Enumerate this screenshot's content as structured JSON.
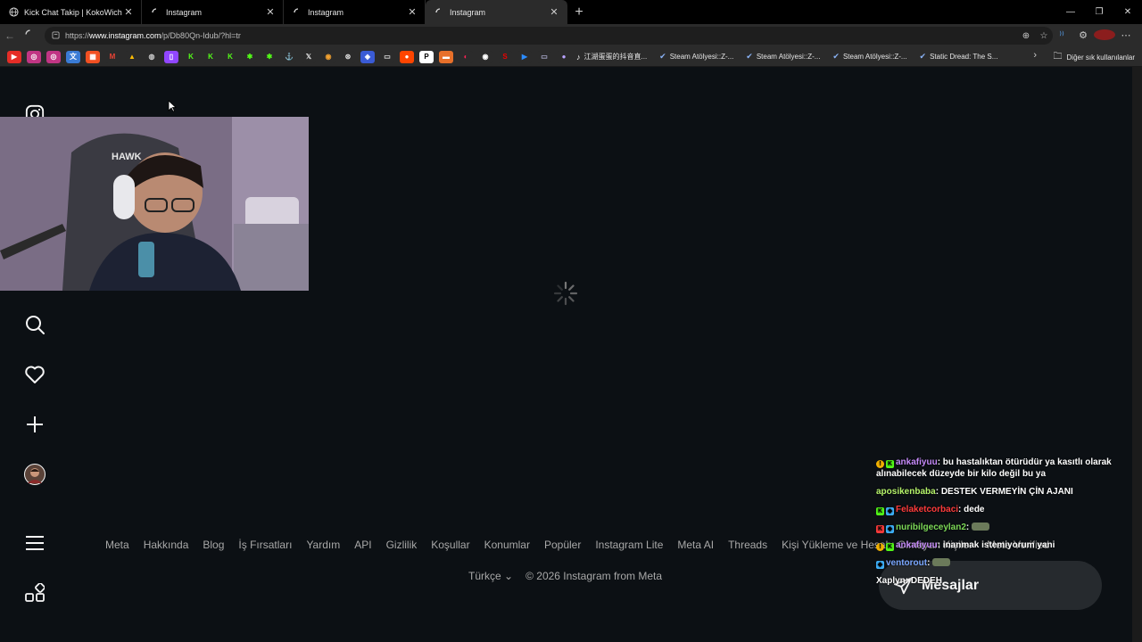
{
  "browser": {
    "tabs": [
      {
        "title": "Kick Chat Takip | KokoWich",
        "icon": "globe-icon",
        "active": false
      },
      {
        "title": "Instagram",
        "icon": "loading-icon",
        "active": false
      },
      {
        "title": "Instagram",
        "icon": "loading-icon",
        "active": false
      },
      {
        "title": "Instagram",
        "icon": "loading-icon",
        "active": true
      }
    ],
    "url_prefix": "https://",
    "url_host": "www.instagram.com",
    "url_path": "/p/Db80Qn-Idub/?hl=tr",
    "bookmarks": [
      {
        "label": "Steam Atölyesi::Z-...",
        "icon": "steam-icon"
      },
      {
        "label": "Steam Atölyesi::Z-...",
        "icon": "steam-icon"
      },
      {
        "label": "Steam Atölyesi::Z-...",
        "icon": "steam-icon"
      },
      {
        "label": "Static Dread: The S...",
        "icon": "steam-icon"
      }
    ],
    "bookmark_cn": "江湖蛋蛋的抖音直...",
    "bookmarks_other": "Diğer sık kullanılanlar"
  },
  "footer": {
    "links": [
      "Meta",
      "Hakkında",
      "Blog",
      "İş Fırsatları",
      "Yardım",
      "API",
      "Gizlilik",
      "Koşullar",
      "Konumlar",
      "Popüler",
      "Instagram Lite",
      "Meta AI",
      "Threads",
      "Kişi Yükleme ve Hesabı Olmayan Kişiler",
      "Meta Verified"
    ],
    "language": "Türkçe",
    "copyright": "© 2026 Instagram from Meta"
  },
  "chat": [
    {
      "user": "ankafiyuu",
      "text": "bu hastalıktan ötürüdür ya kasıtlı olarak alınabilecek düzeyde bir kilo değil bu ya",
      "color": "#c58af9"
    },
    {
      "user": "aposikenbaba",
      "text": "DESTEK VERMEYİN ÇİN AJANI",
      "color": "#b6f36b"
    },
    {
      "user": "Felaketcorbaci",
      "text": "dede",
      "color": "#ff3b3b"
    },
    {
      "user": "nuribilgeceylan2",
      "text": "",
      "color": "#7cd957"
    },
    {
      "user": "ankafiyuu",
      "text": "inanmak istemiyorum yani",
      "color": "#c58af9"
    },
    {
      "user": "ventorout",
      "text": "",
      "color": "#7aa7ff"
    },
    {
      "user": "Xaplyn",
      "text": "DEDEH",
      "color": "#ffffff"
    }
  ],
  "messages_button": "Mesajlar"
}
